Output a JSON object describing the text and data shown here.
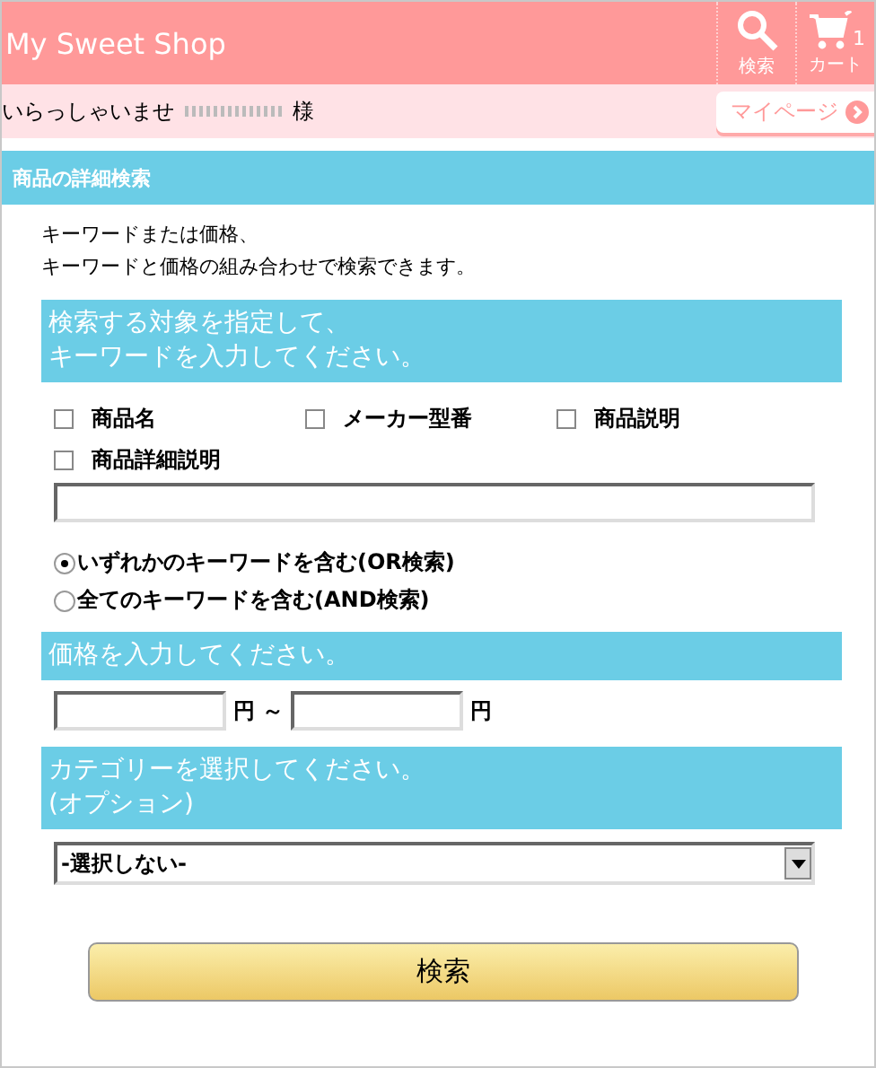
{
  "header": {
    "title": "My Sweet Shop",
    "buttons": [
      {
        "kind": "search",
        "label": "検索"
      },
      {
        "kind": "cart",
        "label": "カート",
        "count": "1"
      }
    ]
  },
  "greeting": {
    "text": "いらっしゃいませ",
    "suffix": "様",
    "mypage": "マイページ"
  },
  "section": {
    "title": "商品の詳細検索",
    "intro": [
      "キーワードまたは価格、",
      "キーワードと価格の組み合わせで検索できます。"
    ]
  },
  "keyword": {
    "heading": [
      "検索する対象を指定して、",
      "キーワードを入力してください。"
    ],
    "targets": [
      {
        "label": "商品名",
        "checked": false
      },
      {
        "label": "メーカー型番",
        "checked": false
      },
      {
        "label": "商品説明",
        "checked": false
      },
      {
        "label": "商品詳細説明",
        "checked": false
      }
    ],
    "modes": [
      {
        "label": "いずれかのキーワードを含む(OR検索)",
        "selected": true
      },
      {
        "label": "全てのキーワードを含む(AND検索)",
        "selected": false
      }
    ]
  },
  "price": {
    "heading": "価格を入力してください。",
    "unit_from": "円",
    "separator": "～",
    "unit_to": "円"
  },
  "category": {
    "heading": [
      "カテゴリーを選択してください。",
      "(オプション)"
    ],
    "value": "-選択しない-"
  },
  "submit": "検索"
}
